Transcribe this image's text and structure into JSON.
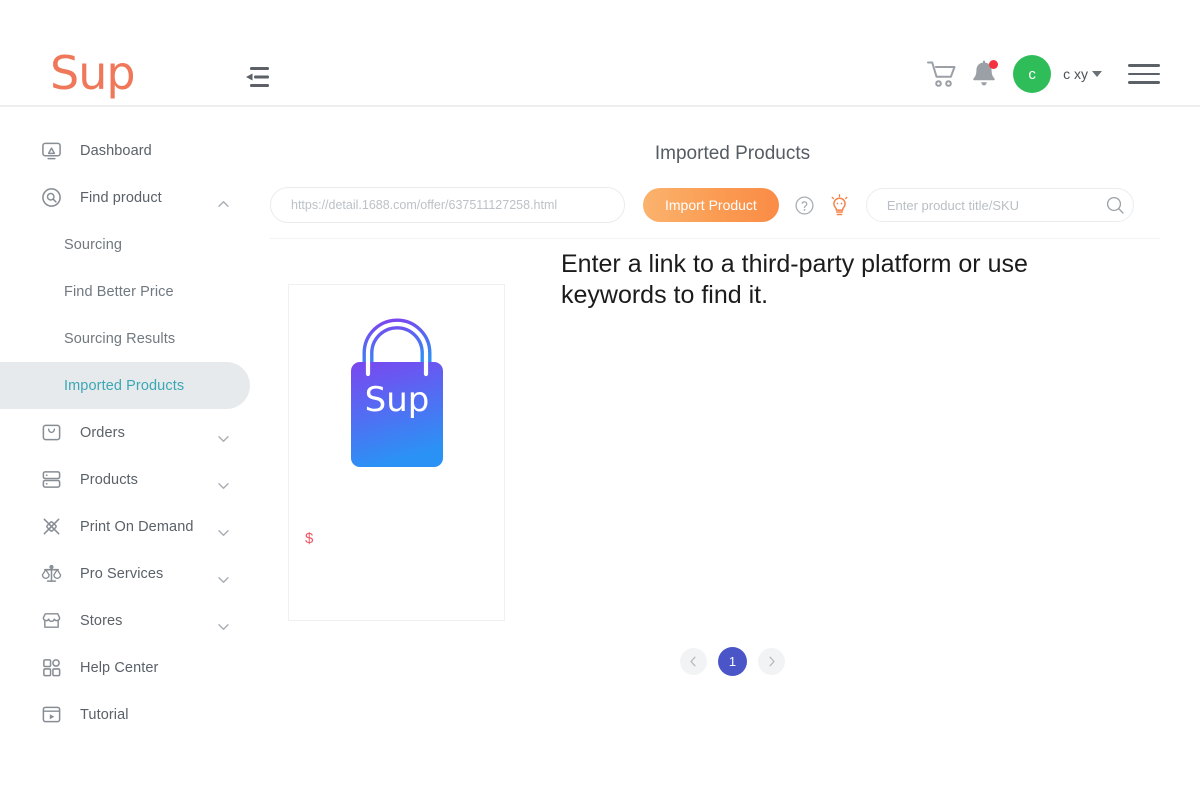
{
  "header": {
    "logo_text": "Sup",
    "collapse_icon": "collapse-sidebar-icon",
    "cart_icon": "shopping-cart-icon",
    "bell_icon": "notification-bell-icon",
    "avatar_initial": "c",
    "user_name": "c xy",
    "menu_icon": "hamburger-menu-icon",
    "avatar_color": "#2ebd59",
    "logo_color": "#f0785a"
  },
  "sidebar": {
    "items": [
      {
        "label": "Dashboard",
        "icon": "monitor-icon",
        "expandable": false,
        "expanded": false
      },
      {
        "label": "Find product",
        "icon": "search-circle-icon",
        "expandable": true,
        "expanded": true
      }
    ],
    "sub_items": [
      {
        "label": "Sourcing",
        "active": false
      },
      {
        "label": "Find Better Price",
        "active": false
      },
      {
        "label": "Sourcing Results",
        "active": false
      },
      {
        "label": "Imported Products",
        "active": true
      }
    ],
    "items_after": [
      {
        "label": "Orders",
        "icon": "bag-icon",
        "expandable": true
      },
      {
        "label": "Products",
        "icon": "layers-icon",
        "expandable": true
      },
      {
        "label": "Print On Demand",
        "icon": "pen-brush-icon",
        "expandable": true
      },
      {
        "label": "Pro Services",
        "icon": "scales-icon",
        "expandable": true
      },
      {
        "label": "Stores",
        "icon": "storefront-icon",
        "expandable": true
      },
      {
        "label": "Help Center",
        "icon": "grid-icon",
        "expandable": false
      },
      {
        "label": "Tutorial",
        "icon": "video-play-icon",
        "expandable": false
      }
    ],
    "active_color": "#3aa8b4",
    "active_bg": "#e7eaec"
  },
  "main": {
    "title": "Imported Products",
    "toolbar": {
      "url_placeholder": "https://detail.1688.com/offer/637511127258.html",
      "url_value": "",
      "import_label": "Import Product",
      "import_color": "#fb9b52",
      "help_icon": "question-circle-icon",
      "bulb_icon": "lightbulb-icon",
      "search_placeholder": "Enter product title/SKU",
      "search_value": "",
      "search_icon": "search-icon"
    },
    "empty_hint": "Enter a link to a third-party platform or use keywords to find it.",
    "product": {
      "image_label": "Sup",
      "price": "$",
      "price_color": "#ef5661"
    },
    "pagination": {
      "prev_icon": "chevron-left-icon",
      "next_icon": "chevron-right-icon",
      "current_page": "1",
      "active_color": "#4a55c8"
    }
  }
}
